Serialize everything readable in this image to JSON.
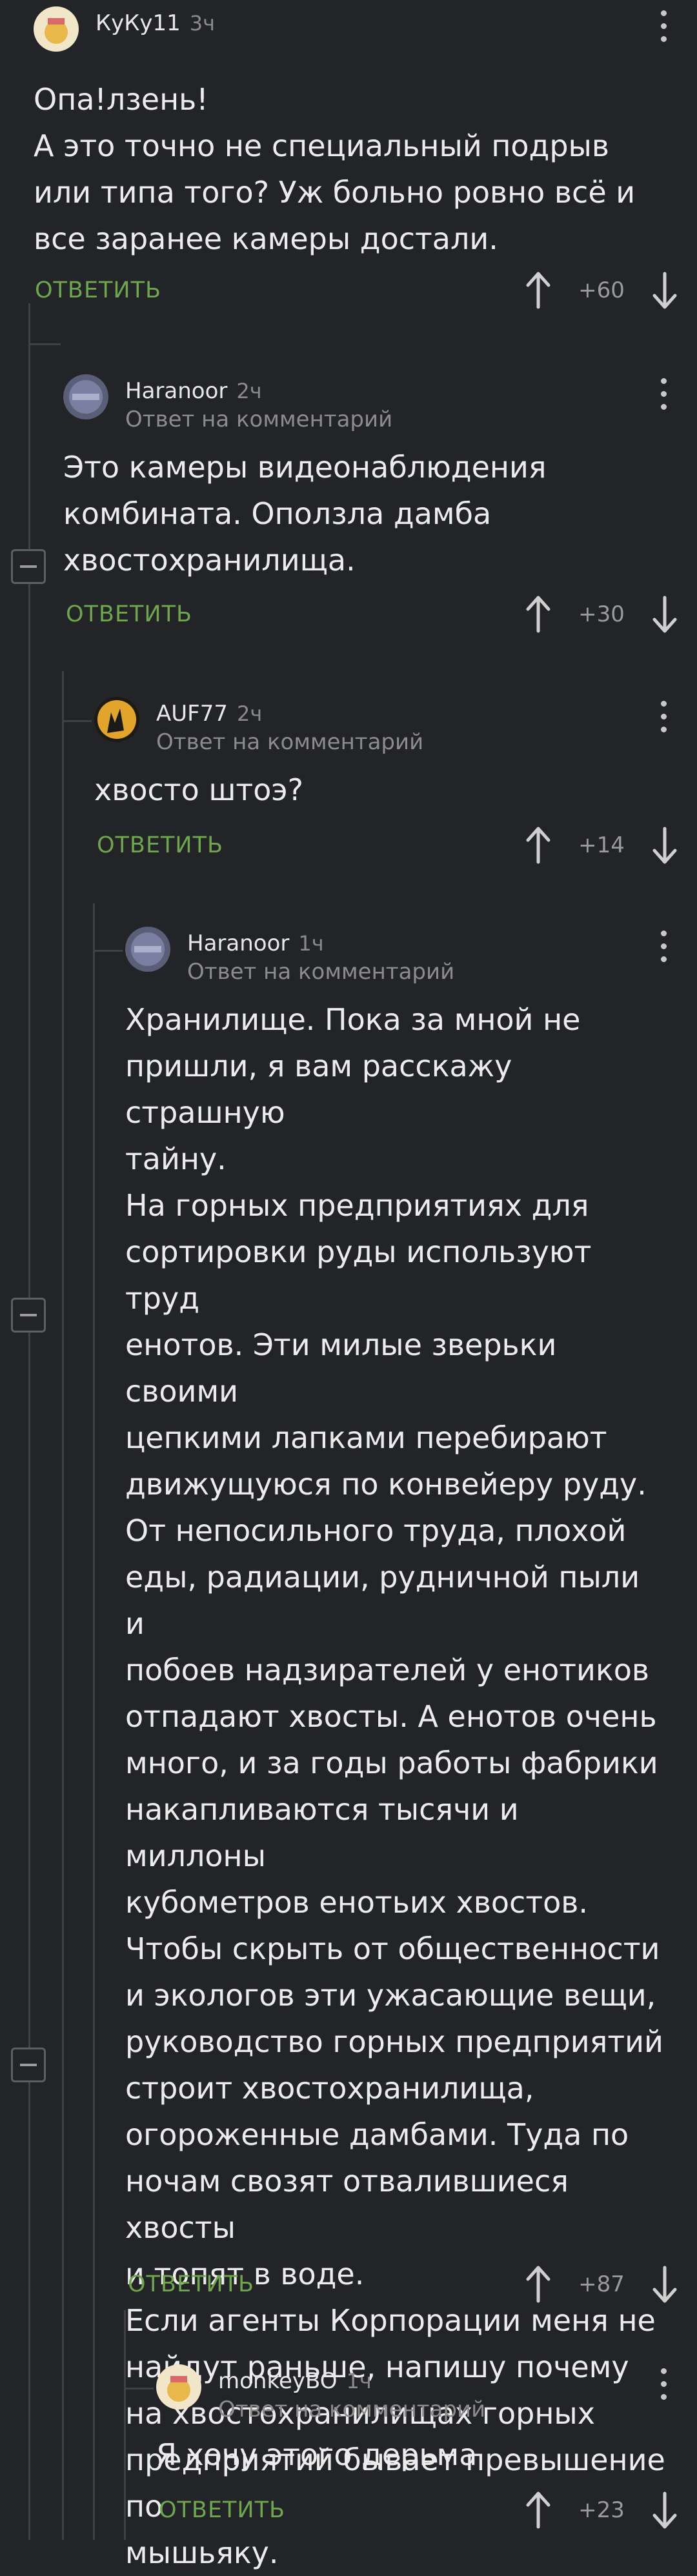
{
  "ui": {
    "reply_label": "ОТВЕТИТЬ",
    "reply_to_label": "Ответ на комментарий"
  },
  "comments": [
    {
      "user": "КуКу11",
      "time": "3ч",
      "text": "Опа!лзень!\nА это точно не специальный подрыв или типа того? Уж больно ровно всё и все заранее камеры достали.",
      "score": "+60"
    },
    {
      "user": "Haranoor",
      "time": "2ч",
      "text": "Это камеры видеонаблюдения\nкомбината. Оползла дамба\nхвостохранилища.",
      "score": "+30"
    },
    {
      "user": "AUF77",
      "time": "2ч",
      "text": "хвосто штоэ?",
      "score": "+14"
    },
    {
      "user": "Haranoor",
      "time": "1ч",
      "text": "Хранилище. Пока за мной не\nпришли, я вам расскажу страшную\nтайну.\nНа горных предприятиях для\nсортировки руды используют труд\nенотов. Эти милые зверьки своими\nцепкими лапками перебирают\nдвижущуюся по конвейеру руду.\nОт непосильного труда, плохой\nеды, радиации, рудничной пыли и\nпобоев надзирателей у енотиков\nотпадают хвосты. А енотов очень\nмного, и за годы работы фабрики\nнакапливаются тысячи и миллоны\nкубометров енотьих хвостов.\nЧтобы скрыть от общественности\nи экологов эти ужасающие вещи,\nруководство горных предприятий\nстроит хвостохранилища,\nогороженные дамбами. Туда по\nночам свозят отвалившиеся хвосты\nи топят в воде.\nЕсли  агенты Корпорации меня не\nнайдут раньше, напишу почему\nна хвостохранилищах горных\nпредприятий бывает превышение по\nмышьяку.",
      "score": "+87"
    },
    {
      "user": "monkeyBO",
      "time": "1ч",
      "text": "Я хочу этого дерьма",
      "score": "+23"
    }
  ]
}
